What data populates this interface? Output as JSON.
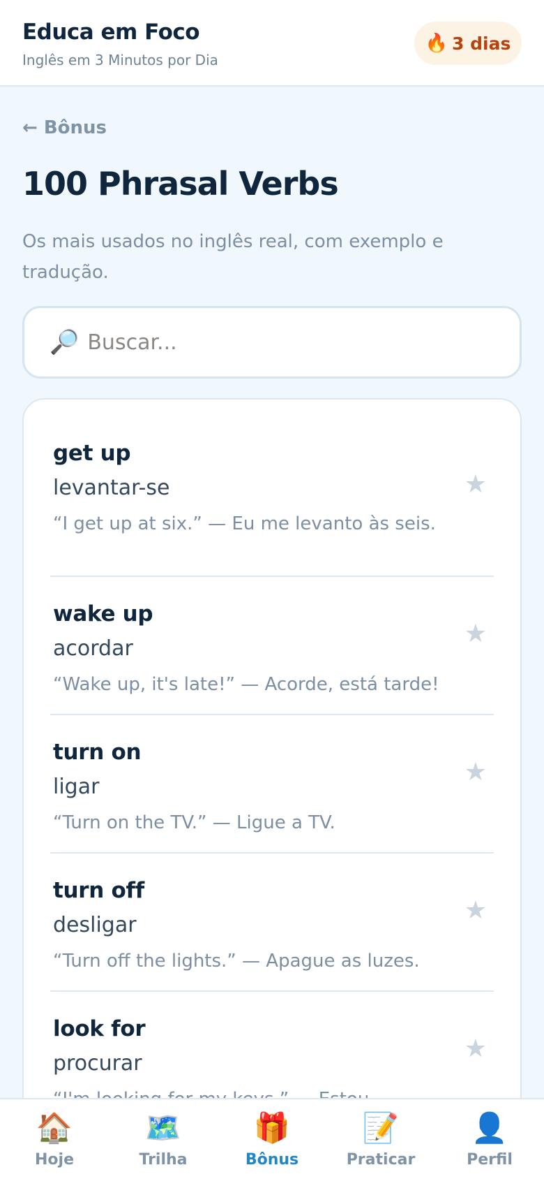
{
  "header": {
    "brand_title": "Educa em Foco",
    "brand_subtitle": "Inglês em 3 Minutos por Dia",
    "streak_icon": "🔥",
    "streak_text": "3 dias"
  },
  "page": {
    "back_label": "← Bônus",
    "title": "100 Phrasal Verbs",
    "description": "Os mais usados no inglês real, com exemplo e tradução."
  },
  "search": {
    "icon": "🔎",
    "placeholder": "Buscar...",
    "value": ""
  },
  "verbs": [
    {
      "term": "get up",
      "translation": "levantar-se",
      "example": "“I get up at six.” — Eu me levanto às seis.",
      "star": "★"
    },
    {
      "term": "wake up",
      "translation": "acordar",
      "example": "“Wake up, it's late!” — Acorde, está tarde!",
      "star": "★"
    },
    {
      "term": "turn on",
      "translation": "ligar",
      "example": "“Turn on the TV.” — Ligue a TV.",
      "star": "★"
    },
    {
      "term": "turn off",
      "translation": "desligar",
      "example": "“Turn off the lights.” — Apague as luzes.",
      "star": "★"
    },
    {
      "term": "look for",
      "translation": "procurar",
      "example": "“I'm looking for my keys.” — Estou",
      "star": "★"
    }
  ],
  "nav": [
    {
      "icon": "🏠",
      "label": "Hoje"
    },
    {
      "icon": "🗺️",
      "label": "Trilha"
    },
    {
      "icon": "🎁",
      "label": "Bônus"
    },
    {
      "icon": "📝",
      "label": "Praticar"
    },
    {
      "icon": "👤",
      "label": "Perfil"
    }
  ],
  "colors": {
    "accent": "#1f86c7",
    "streak_text": "#b8420e",
    "title": "#10263d",
    "muted": "#7c8ea2"
  }
}
